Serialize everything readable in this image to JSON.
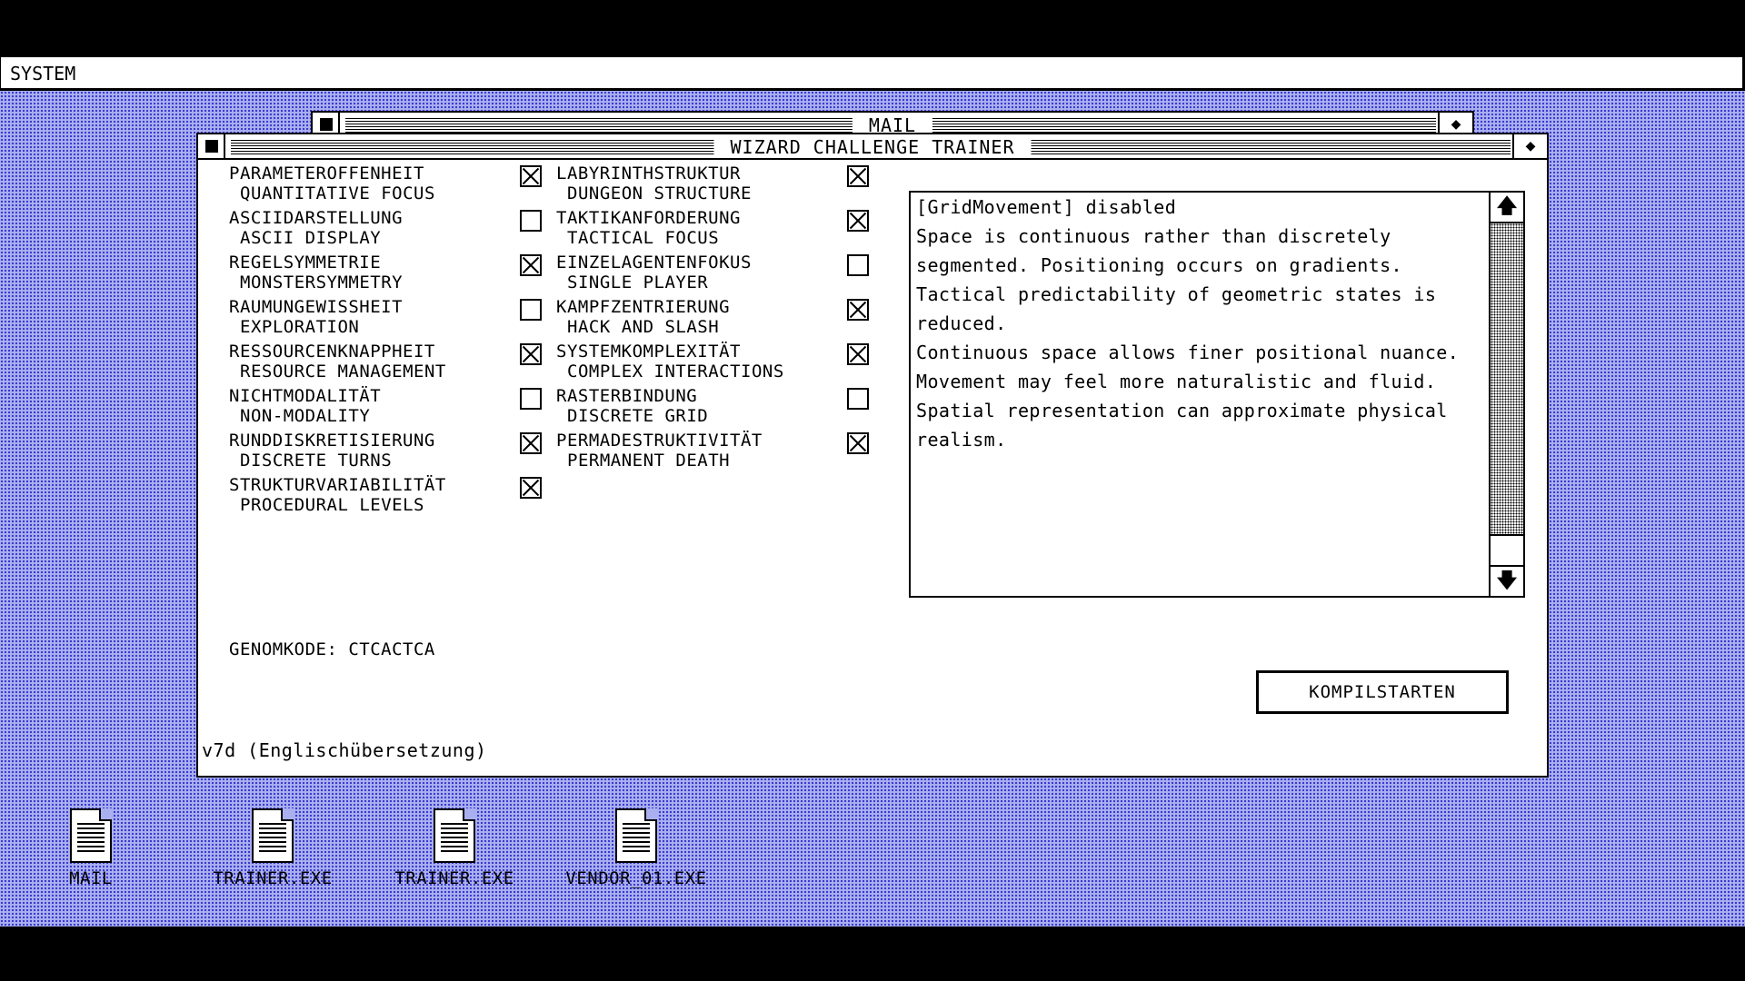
{
  "menubar": {
    "title": "SYSTEM"
  },
  "background_window": {
    "title": "MAIL"
  },
  "window": {
    "title": "WIZARD CHALLENGE TRAINER",
    "zoom_glyph": "◆",
    "options_left": [
      {
        "de": "PARAMETEROFFENHEIT",
        "en": "QUANTITATIVE FOCUS",
        "checked": true
      },
      {
        "de": "ASCIIDARSTELLUNG",
        "en": "ASCII DISPLAY",
        "checked": false
      },
      {
        "de": "REGELSYMMETRIE",
        "en": "MONSTERSYMMETRY",
        "checked": true
      },
      {
        "de": "RAUMUNGEWISSHEIT",
        "en": "EXPLORATION",
        "checked": false
      },
      {
        "de": "RESSOURCENKNAPPHEIT",
        "en": "RESOURCE MANAGEMENT",
        "checked": true
      },
      {
        "de": "NICHTMODALITÄT",
        "en": "NON-MODALITY",
        "checked": false
      },
      {
        "de": "RUNDDISKRETISIERUNG",
        "en": "DISCRETE TURNS",
        "checked": true
      },
      {
        "de": "STRUKTURVARIABILITÄT",
        "en": "PROCEDURAL LEVELS",
        "checked": true
      }
    ],
    "options_right": [
      {
        "de": "LABYRINTHSTRUKTUR",
        "en": "DUNGEON STRUCTURE",
        "checked": true
      },
      {
        "de": "TAKTIKANFORDERUNG",
        "en": "TACTICAL FOCUS",
        "checked": true
      },
      {
        "de": "EINZELAGENTENFOKUS",
        "en": "SINGLE PLAYER",
        "checked": false
      },
      {
        "de": "KAMPFZENTRIERUNG",
        "en": "HACK AND SLASH",
        "checked": true
      },
      {
        "de": "SYSTEMKOMPLEXITÄT",
        "en": "COMPLEX INTERACTIONS",
        "checked": true
      },
      {
        "de": "RASTERBINDUNG",
        "en": "DISCRETE GRID",
        "checked": false
      },
      {
        "de": "PERMADESTRUKTIVITÄT",
        "en": "PERMANENT DEATH",
        "checked": true
      }
    ],
    "genome": "GENOMKODE: CTCACTCA",
    "log": "[GridMovement] disabled\nSpace is continuous rather than discretely segmented. Positioning occurs on gradients. Tactical predictability of geometric states is reduced.\nContinuous space allows finer positional nuance. Movement may feel more naturalistic and fluid. Spatial representation can approximate physical realism.",
    "scroll_up": "🡅",
    "scroll_down": "🡇",
    "compile_label": "KOMPILSTARTEN",
    "version": "v7d (Englischübersetzung)"
  },
  "desktop_icons": [
    {
      "label": "MAIL",
      "icon": "document-icon"
    },
    {
      "label": "TRAINER.EXE",
      "icon": "document-icon"
    },
    {
      "label": "TRAINER.EXE",
      "icon": "document-icon"
    },
    {
      "label": "VENDOR_01.EXE",
      "icon": "document-icon"
    }
  ]
}
